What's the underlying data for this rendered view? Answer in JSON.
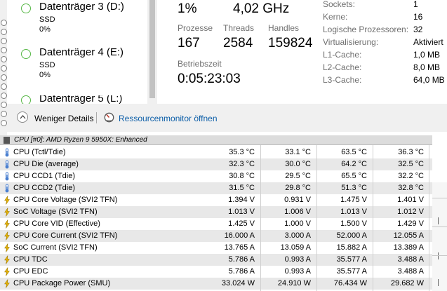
{
  "disks": [
    {
      "name": "Datenträger 3 (D:)",
      "type": "SSD",
      "usage": "0%"
    },
    {
      "name": "Datenträger 4 (E:)",
      "type": "SSD",
      "usage": "0%"
    },
    {
      "name": "Datenträger 5 (L:)"
    }
  ],
  "cpu": {
    "utilization": "1%",
    "speed": "4,02 GHz",
    "processes_label": "Prozesse",
    "processes": "167",
    "threads_label": "Threads",
    "threads": "2584",
    "handles_label": "Handles",
    "handles": "159824",
    "uptime_label": "Betriebszeit",
    "uptime": "0:05:23:03"
  },
  "properties": [
    {
      "label": "Sockets:",
      "value": "1"
    },
    {
      "label": "Kerne:",
      "value": "16"
    },
    {
      "label": "Logische Prozessoren:",
      "value": "32"
    },
    {
      "label": "Virtualisierung:",
      "value": "Aktiviert"
    },
    {
      "label": "L1-Cache:",
      "value": "1,0 MB"
    },
    {
      "label": "L2-Cache:",
      "value": "8,0 MB"
    },
    {
      "label": "L3-Cache:",
      "value": "64,0 MB"
    }
  ],
  "footer": {
    "fewer_details": "Weniger Details",
    "resource_monitor": "Ressourcenmonitor öffnen"
  },
  "sensors": {
    "group_title": "CPU [#0]: AMD Ryzen 9 5950X: Enhanced",
    "rows": [
      {
        "name": "CPU (Tctl/Tdie)",
        "icon": "thermometer-icon",
        "current": "35.3 °C",
        "min": "33.1 °C",
        "max": "63.5 °C",
        "avg": "36.3 °C"
      },
      {
        "name": "CPU Die (average)",
        "icon": "thermometer-icon",
        "current": "32.3 °C",
        "min": "30.0 °C",
        "max": "64.2 °C",
        "avg": "32.5 °C"
      },
      {
        "name": "CPU CCD1 (Tdie)",
        "icon": "thermometer-icon",
        "current": "30.8 °C",
        "min": "29.5 °C",
        "max": "65.5 °C",
        "avg": "32.2 °C"
      },
      {
        "name": "CPU CCD2 (Tdie)",
        "icon": "thermometer-icon",
        "current": "31.5 °C",
        "min": "29.8 °C",
        "max": "51.3 °C",
        "avg": "32.8 °C"
      },
      {
        "name": "CPU Core Voltage (SVI2 TFN)",
        "icon": "lightning-icon",
        "current": "1.394 V",
        "min": "0.931 V",
        "max": "1.475 V",
        "avg": "1.401 V"
      },
      {
        "name": "SoC Voltage (SVI2 TFN)",
        "icon": "lightning-icon",
        "current": "1.013 V",
        "min": "1.006 V",
        "max": "1.013 V",
        "avg": "1.012 V"
      },
      {
        "name": "CPU Core VID (Effective)",
        "icon": "lightning-icon",
        "current": "1.425 V",
        "min": "1.000 V",
        "max": "1.500 V",
        "avg": "1.429 V"
      },
      {
        "name": "CPU Core Current (SVI2 TFN)",
        "icon": "lightning-icon",
        "current": "16.000 A",
        "min": "3.000 A",
        "max": "52.000 A",
        "avg": "12.055 A"
      },
      {
        "name": "SoC Current (SVI2 TFN)",
        "icon": "lightning-icon",
        "current": "13.765 A",
        "min": "13.059 A",
        "max": "15.882 A",
        "avg": "13.389 A"
      },
      {
        "name": "CPU TDC",
        "icon": "lightning-icon",
        "current": "5.786 A",
        "min": "0.993 A",
        "max": "35.577 A",
        "avg": "3.488 A"
      },
      {
        "name": "CPU EDC",
        "icon": "lightning-icon",
        "current": "5.786 A",
        "min": "0.993 A",
        "max": "35.577 A",
        "avg": "3.488 A"
      },
      {
        "name": "CPU Package Power (SMU)",
        "icon": "lightning-icon",
        "current": "33.024 W",
        "min": "24.910 W",
        "max": "76.434 W",
        "avg": "29.682 W"
      }
    ]
  },
  "colors": {
    "disk_indicator": "#58b848",
    "link": "#0c5ea8",
    "thermometer": "#4a7fd0",
    "lightning": "#e8b400"
  }
}
